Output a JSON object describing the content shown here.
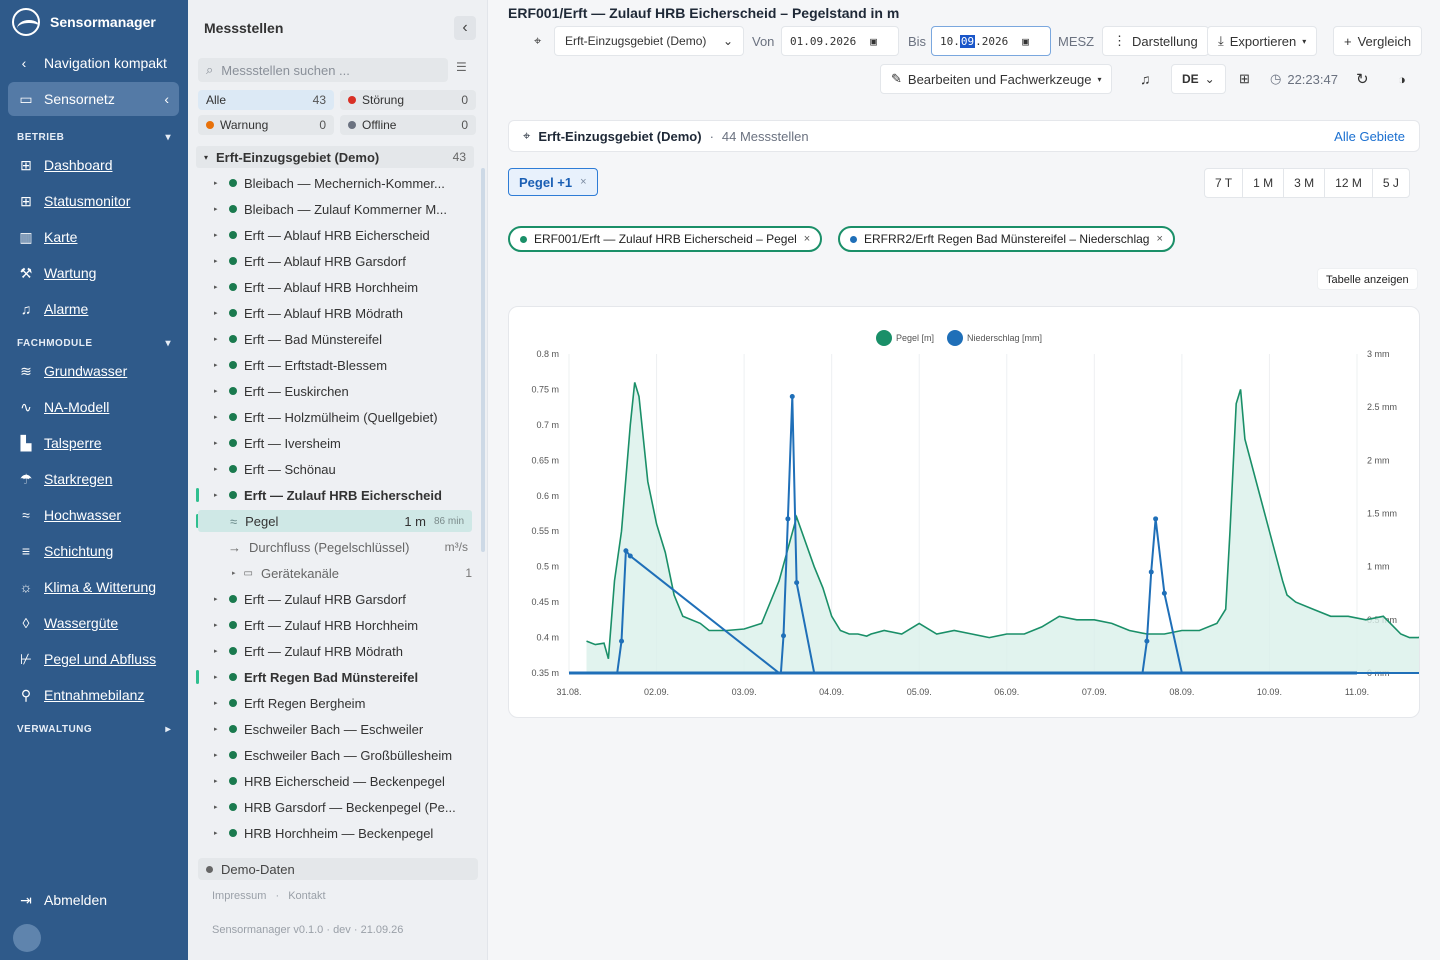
{
  "sidebar": {
    "app_title": "Sensormanager",
    "nav_compact": "Navigation kompakt",
    "active_section": "Sensornetz",
    "sections": [
      {
        "label": "BETRIEB",
        "items": [
          {
            "label": "Dashboard",
            "icon": "grid-icon"
          },
          {
            "label": "Statusmonitor",
            "icon": "grid-icon"
          },
          {
            "label": "Karte",
            "icon": "map-icon"
          },
          {
            "label": "Wartung",
            "icon": "wrench-icon"
          },
          {
            "label": "Alarme",
            "icon": "bell-icon"
          }
        ]
      },
      {
        "label": "FACHMODULE",
        "items": [
          {
            "label": "Grundwasser",
            "icon": "water-icon"
          },
          {
            "label": "NA-Modell",
            "icon": "chart-line-icon"
          },
          {
            "label": "Talsperre",
            "icon": "dam-icon"
          },
          {
            "label": "Starkregen",
            "icon": "rain-icon"
          },
          {
            "label": "Hochwasser",
            "icon": "flood-icon"
          },
          {
            "label": "Schichtung",
            "icon": "layers-icon"
          },
          {
            "label": "Klima & Witterung",
            "icon": "sun-icon"
          },
          {
            "label": "Wassergüte",
            "icon": "drop-icon"
          },
          {
            "label": "Pegel und Abfluss",
            "icon": "gauge-icon"
          },
          {
            "label": "Entnahmebilanz",
            "icon": "tap-icon"
          }
        ]
      },
      {
        "label": "VERWALTUNG",
        "items": []
      }
    ],
    "logout": "Abmelden"
  },
  "panel": {
    "title": "Messstellen",
    "search_placeholder": "Messstellen suchen ...",
    "filters": [
      {
        "label": "Alle",
        "count": "43",
        "color": ""
      },
      {
        "label": "Störung",
        "count": "0",
        "color": "#d93025"
      },
      {
        "label": "Warnung",
        "count": "0",
        "color": "#e8710a"
      },
      {
        "label": "Offline",
        "count": "0",
        "color": "#6b7280"
      }
    ],
    "group": {
      "label": "Erft-Einzugsgebiet (Demo)",
      "count": "43"
    },
    "stations_top": [
      "Bleibach — Mechernich-Kommer...",
      "Bleibach — Zulauf Kommerner M...",
      "Erft — Ablauf HRB Eicherscheid",
      "Erft — Ablauf HRB Garsdorf",
      "Erft — Ablauf HRB Horchheim",
      "Erft — Ablauf HRB Mödrath",
      "Erft — Bad Münstereifel",
      "Erft — Erftstadt-Blessem",
      "Erft — Euskirchen",
      "Erft — Holzmülheim (Quellgebiet)",
      "Erft — Iversheim",
      "Erft — Schönau",
      "Erft — Zulauf HRB Eicherscheid"
    ],
    "expanded": {
      "pegel": {
        "label": "Pegel",
        "value": "1 m",
        "age": "86 min"
      },
      "durchfluss": {
        "label": "Durchfluss (Pegelschlüssel)",
        "unit": "m³/s"
      },
      "geraete": {
        "label": "Gerätekanäle",
        "count": "1"
      }
    },
    "stations_bottom": [
      "Erft — Zulauf HRB Garsdorf",
      "Erft — Zulauf HRB Horchheim",
      "Erft — Zulauf HRB Mödrath",
      "Erft Regen Bad Münstereifel",
      "Erft Regen Bergheim",
      "Eschweiler Bach — Eschweiler",
      "Eschweiler Bach — Großbüllesheim",
      "HRB Eicherscheid — Beckenpegel",
      "HRB Garsdorf — Beckenpegel (Pe...",
      "HRB Horchheim — Beckenpegel"
    ],
    "demo_label": "Demo-Daten",
    "footer_links": [
      "Impressum",
      "Kontakt"
    ],
    "version": "Sensormanager v0.1.0 · dev · 21.09.26"
  },
  "main": {
    "title": "ERF001/Erft — Zulauf HRB Eicherscheid – Pegelstand in m",
    "area_select": "Erft-Einzugsgebiet (Demo)",
    "von_label": "Von",
    "von_date": {
      "day": "01",
      "month": "09",
      "year": "2026"
    },
    "bis_label": "Bis",
    "bis_date": {
      "day": "10",
      "month": "09",
      "year": "2026"
    },
    "tz": "MESZ",
    "darstellung": "Darstellung",
    "exportieren": "Exportieren",
    "vergleich": "Vergleich",
    "bearbeiten": "Bearbeiten und Fachwerkzeuge",
    "lang": "DE",
    "clock": "22:23:47",
    "area_bar": {
      "name": "Erft-Einzugsgebiet (Demo)",
      "count_text": "44 Messstellen",
      "link": "Alle Gebiete"
    },
    "pegel_filter": "Pegel +1",
    "ranges": [
      "7 T",
      "1 M",
      "3 M",
      "12 M",
      "5 J"
    ],
    "series_pills": [
      "ERF001/Erft — Zulauf HRB Eicherscheid – Pegel",
      "ERFRR2/Erft Regen Bad Münstereifel – Niederschlag"
    ],
    "table_button": "Tabelle anzeigen"
  },
  "chart_data": {
    "type": "line",
    "series": [
      {
        "name": "Pegel [m]",
        "color": "#1a8f68",
        "axis": "left",
        "x": [
          0.2,
          0.3,
          0.4,
          0.45,
          0.52,
          0.6,
          0.7,
          0.75,
          0.8,
          0.9,
          1.0,
          1.1,
          1.2,
          1.3,
          1.5,
          1.6,
          1.8,
          2.0,
          2.2,
          2.4,
          2.6,
          2.8,
          2.9,
          3.0,
          3.1,
          3.2,
          3.3,
          3.4,
          3.45,
          3.6,
          3.8,
          4.0,
          4.2,
          4.4,
          4.6,
          4.8,
          5.0,
          5.2,
          5.4,
          5.6,
          5.8,
          6.0,
          6.2,
          6.4,
          6.6,
          6.8,
          7.0,
          7.2,
          7.4,
          7.5,
          7.55,
          7.62,
          7.67,
          7.72,
          8.15,
          8.2,
          8.3,
          8.5,
          8.7,
          8.9,
          9.1,
          9.3,
          9.5,
          9.6,
          9.7,
          9.8
        ],
        "y": [
          0.395,
          0.39,
          0.392,
          0.37,
          0.48,
          0.55,
          0.7,
          0.76,
          0.74,
          0.62,
          0.56,
          0.52,
          0.46,
          0.43,
          0.42,
          0.41,
          0.41,
          0.412,
          0.42,
          0.48,
          0.57,
          0.5,
          0.47,
          0.43,
          0.41,
          0.405,
          0.405,
          0.402,
          0.405,
          0.41,
          0.405,
          0.42,
          0.405,
          0.41,
          0.405,
          0.4,
          0.405,
          0.405,
          0.415,
          0.43,
          0.425,
          0.425,
          0.42,
          0.41,
          0.405,
          0.405,
          0.41,
          0.41,
          0.42,
          0.44,
          0.55,
          0.73,
          0.75,
          0.68,
          0.48,
          0.46,
          0.45,
          0.44,
          0.43,
          0.43,
          0.425,
          0.43,
          0.405,
          0.4,
          0.4,
          0.405
        ]
      },
      {
        "name": "Niederschlag [mm]",
        "color": "#1f6fb8",
        "axis": "right",
        "x": [
          0.0,
          0.5,
          0.55,
          0.6,
          0.65,
          0.7,
          2.4,
          2.42,
          2.45,
          2.5,
          2.55,
          2.6,
          2.8,
          6.5,
          6.55,
          6.6,
          6.65,
          6.7,
          6.8,
          7.0,
          8.8,
          9.8
        ],
        "y": [
          0,
          0,
          0,
          0.3,
          1.15,
          1.1,
          0,
          0,
          0.35,
          1.45,
          2.6,
          0.85,
          0,
          0,
          0,
          0.3,
          0.95,
          1.45,
          0.75,
          0,
          0,
          0
        ]
      }
    ],
    "x_ticks": [
      "31.08.",
      "02.09.",
      "03.09.",
      "04.09.",
      "05.09.",
      "06.09.",
      "07.09.",
      "08.09.",
      "10.09.",
      "11.09."
    ],
    "y_left_ticks": [
      "0.8 m",
      "0.75 m",
      "0.7 m",
      "0.65 m",
      "0.6 m",
      "0.55 m",
      "0.5 m",
      "0.45 m",
      "0.4 m",
      "0.35 m"
    ],
    "y_right_ticks": [
      "3 mm",
      "2.5 mm",
      "2 mm",
      "1.5 mm",
      "1 mm",
      "0.5 mm",
      "0 mm"
    ],
    "ylim_left": [
      0.35,
      0.8
    ],
    "ylim_right": [
      0,
      3
    ],
    "xlim": [
      0,
      9
    ],
    "legend_position": "top-center",
    "grid": true
  }
}
